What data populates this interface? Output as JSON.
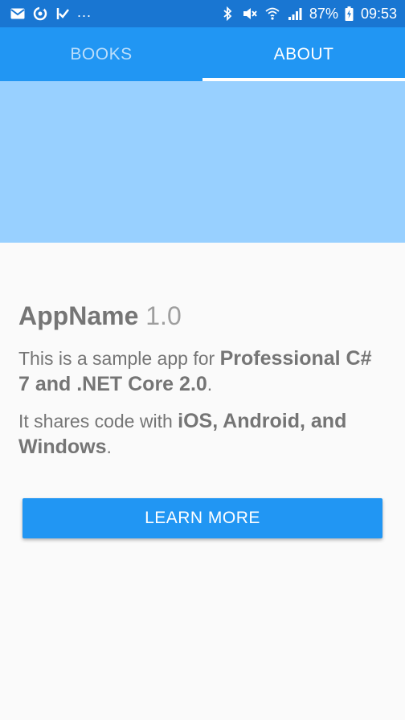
{
  "status_bar": {
    "left_icons": [
      "mail-icon",
      "sync-icon",
      "check-flag-icon"
    ],
    "overflow": "...",
    "right_icons": [
      "bluetooth-icon",
      "mute-icon",
      "wifi-icon",
      "signal-icon"
    ],
    "battery": "87%",
    "battery_icon": "battery-charging-icon",
    "time": "09:53"
  },
  "tabs": [
    {
      "label": "BOOKS",
      "selected": false
    },
    {
      "label": "ABOUT",
      "selected": true
    }
  ],
  "about": {
    "app_name": "AppName",
    "version": "1.0",
    "p1_text": "This is a sample app for ",
    "p1_bold": "Professional C# 7 and .NET Core 2.0",
    "p1_end": ".",
    "p2_text": "It shares code with ",
    "p2_bold": "iOS, Android, and Windows",
    "p2_end": ".",
    "button_label": "LEARN MORE"
  },
  "colors": {
    "status_bar": "#1976d2",
    "tab_bar": "#2196f3",
    "hero": "#98d0ff",
    "button": "#2196f3",
    "text": "#757575"
  }
}
